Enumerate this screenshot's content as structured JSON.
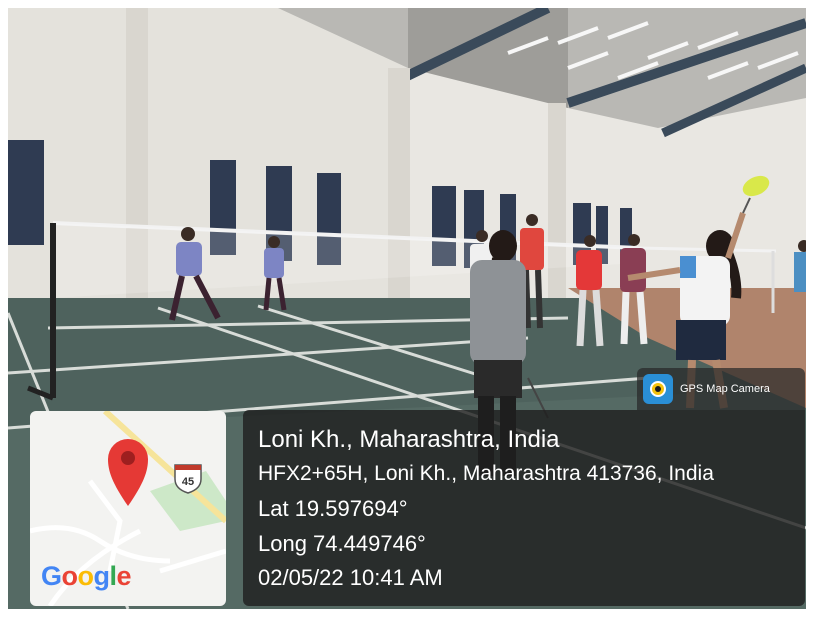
{
  "overlay": {
    "app_name": "GPS Map Camera",
    "place_title": "Loni Kh., Maharashtra, India",
    "address": "HFX2+65H, Loni Kh., Maharashtra 413736, India",
    "latitude": "Lat 19.597694°",
    "longitude": "Long 74.449746°",
    "datetime": "02/05/22 10:41 AM"
  },
  "map": {
    "road_shield": "45",
    "brand_letters": [
      {
        "char": "G",
        "color": "#4285F4"
      },
      {
        "char": "o",
        "color": "#EA4335"
      },
      {
        "char": "o",
        "color": "#FBBC05"
      },
      {
        "char": "g",
        "color": "#4285F4"
      },
      {
        "char": "l",
        "color": "#34A853"
      },
      {
        "char": "e",
        "color": "#EA4335"
      }
    ],
    "pin_color": "#E53935"
  },
  "icons": [
    "gps-map-camera-icon",
    "map-pin-icon",
    "highway-shield-icon"
  ]
}
